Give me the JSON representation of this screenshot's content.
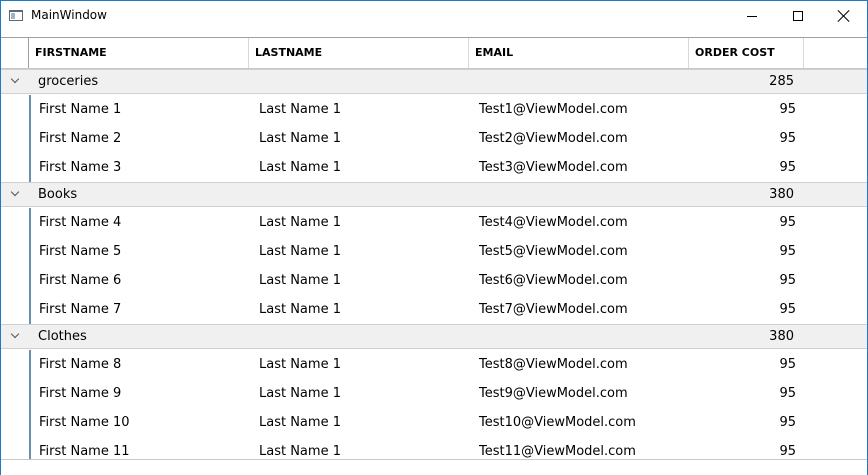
{
  "window": {
    "title": "MainWindow"
  },
  "columns": [
    "FIRSTNAME",
    "LASTNAME",
    "EMAIL",
    "ORDER COST"
  ],
  "groups": [
    {
      "name": "groceries",
      "total": "285",
      "rows": [
        [
          "First Name 1",
          "Last Name 1",
          "Test1@ViewModel.com",
          "95"
        ],
        [
          "First Name 2",
          "Last Name 1",
          "Test2@ViewModel.com",
          "95"
        ],
        [
          "First Name 3",
          "Last Name 1",
          "Test3@ViewModel.com",
          "95"
        ]
      ]
    },
    {
      "name": "Books",
      "total": "380",
      "rows": [
        [
          "First Name 4",
          "Last Name 1",
          "Test4@ViewModel.com",
          "95"
        ],
        [
          "First Name 5",
          "Last Name 1",
          "Test5@ViewModel.com",
          "95"
        ],
        [
          "First Name 6",
          "Last Name 1",
          "Test6@ViewModel.com",
          "95"
        ],
        [
          "First Name 7",
          "Last Name 1",
          "Test7@ViewModel.com",
          "95"
        ]
      ]
    },
    {
      "name": "Clothes",
      "total": "380",
      "rows": [
        [
          "First Name 8",
          "Last Name 1",
          "Test8@ViewModel.com",
          "95"
        ],
        [
          "First Name 9",
          "Last Name 1",
          "Test9@ViewModel.com",
          "95"
        ],
        [
          "First Name 10",
          "Last Name 1",
          "Test10@ViewModel.com",
          "95"
        ],
        [
          "First Name 11",
          "Last Name 1",
          "Test11@ViewModel.com",
          "95"
        ]
      ]
    }
  ],
  "icons": {
    "app": "window-app-icon",
    "minimize": "minimize-icon",
    "maximize": "maximize-icon",
    "close": "close-icon",
    "expand": "chevron-down-icon"
  }
}
